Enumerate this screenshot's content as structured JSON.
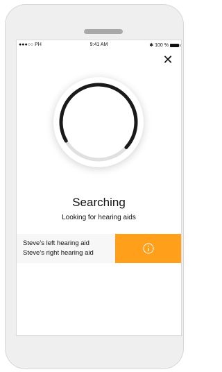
{
  "status_bar": {
    "carrier": "●●●○○ PH",
    "time": "9:41 AM",
    "battery": "100 %"
  },
  "close_icon": "✕",
  "title": "Searching",
  "subtitle": "Looking for hearing aids",
  "devices": [
    {
      "name": "Steve’s left hearing aid"
    },
    {
      "name": "Steve’s right hearing aid"
    }
  ],
  "colors": {
    "accent": "#ff9f1a",
    "spinner": "#1a1a1a",
    "spinner_track": "#e0e0e0"
  },
  "spinner_progress": 0.7
}
